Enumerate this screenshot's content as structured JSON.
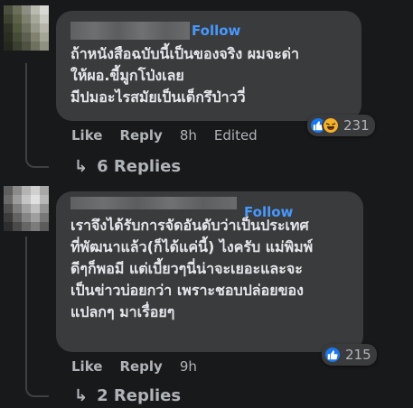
{
  "comments": [
    {
      "follow_label": "Follow",
      "lines": [
        "ถ้าหนังสือฉบับนี้เป็นของจริง ผมจะด่า",
        "ให้ผอ.ขี้มูกโป่งเลย",
        "มีปมอะไรสมัยเป็นเด็กรึป่าววี่"
      ],
      "reaction_icons": [
        "like-icon",
        "haha-icon"
      ],
      "reaction_count": "231",
      "actions": {
        "like_label": "Like",
        "reply_label": "Reply",
        "time": "8h",
        "edited_label": "Edited"
      },
      "replies_label": "6 Replies"
    },
    {
      "follow_label": "Follow",
      "lines": [
        "เราจึงได้รับการจัดอันดับว่าเป็นประเทศ",
        "ที่พัฒนาแล้ว(ก็ได้แค่นี้) ไงครับ แม่พิมพ์",
        "ดีๆก็พอมี แต่เบี้ยวๆนี่น่าจะเยอะและจะ",
        "เป็นข่าวบ่อยกว่า เพราะชอบปล่อยของ",
        "แปลกๆ มาเรื่อยๆ"
      ],
      "reaction_icons": [
        "like-icon"
      ],
      "reaction_count": "215",
      "actions": {
        "like_label": "Like",
        "reply_label": "Reply",
        "time": "9h"
      },
      "replies_label": "2 Replies"
    }
  ],
  "colors": {
    "background": "#18191a",
    "bubble": "#3a3b3c",
    "follow": "#4599ff",
    "secondary_text": "#b0b3b8",
    "like_blue": "#1877f2",
    "haha_yellow": "#f7b125"
  }
}
